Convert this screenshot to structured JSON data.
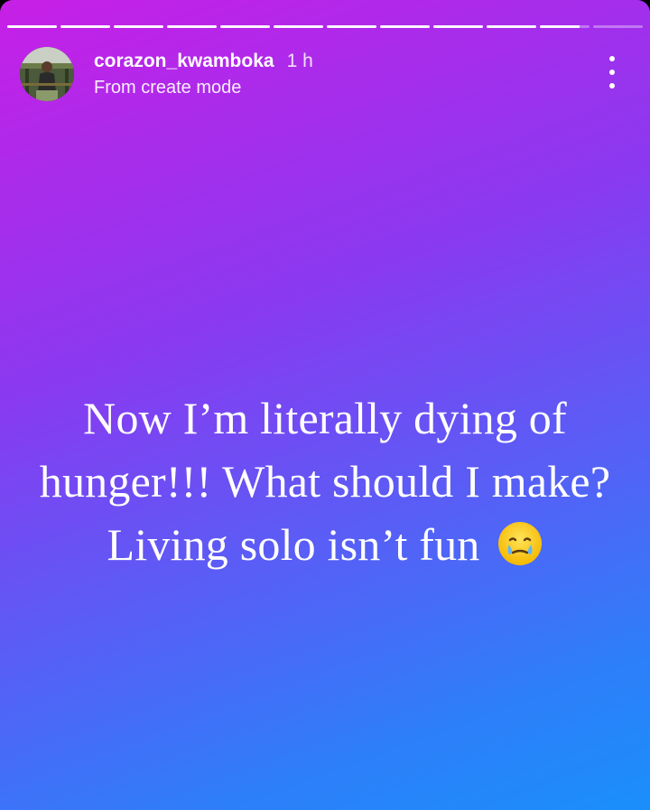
{
  "story": {
    "progress": {
      "segment_count": 12,
      "current_index": 10,
      "current_fraction": 0.8
    },
    "header": {
      "username": "corazon_kwamboka",
      "time": "1 h",
      "subline": "From create mode"
    },
    "caption": {
      "text": "Now I’m literally dying of hunger!!! What should I make? Living solo isn’t fun",
      "emoji": "face-holding-back-tears"
    },
    "colors": {
      "gradient_start": "#c81fe6",
      "gradient_mid": "#5b5cf6",
      "gradient_end": "#1a8ffb",
      "text": "#ffffff"
    },
    "icons": {
      "more": "more-vertical-icon",
      "emoji": "teary-smile-emoji-icon"
    }
  }
}
